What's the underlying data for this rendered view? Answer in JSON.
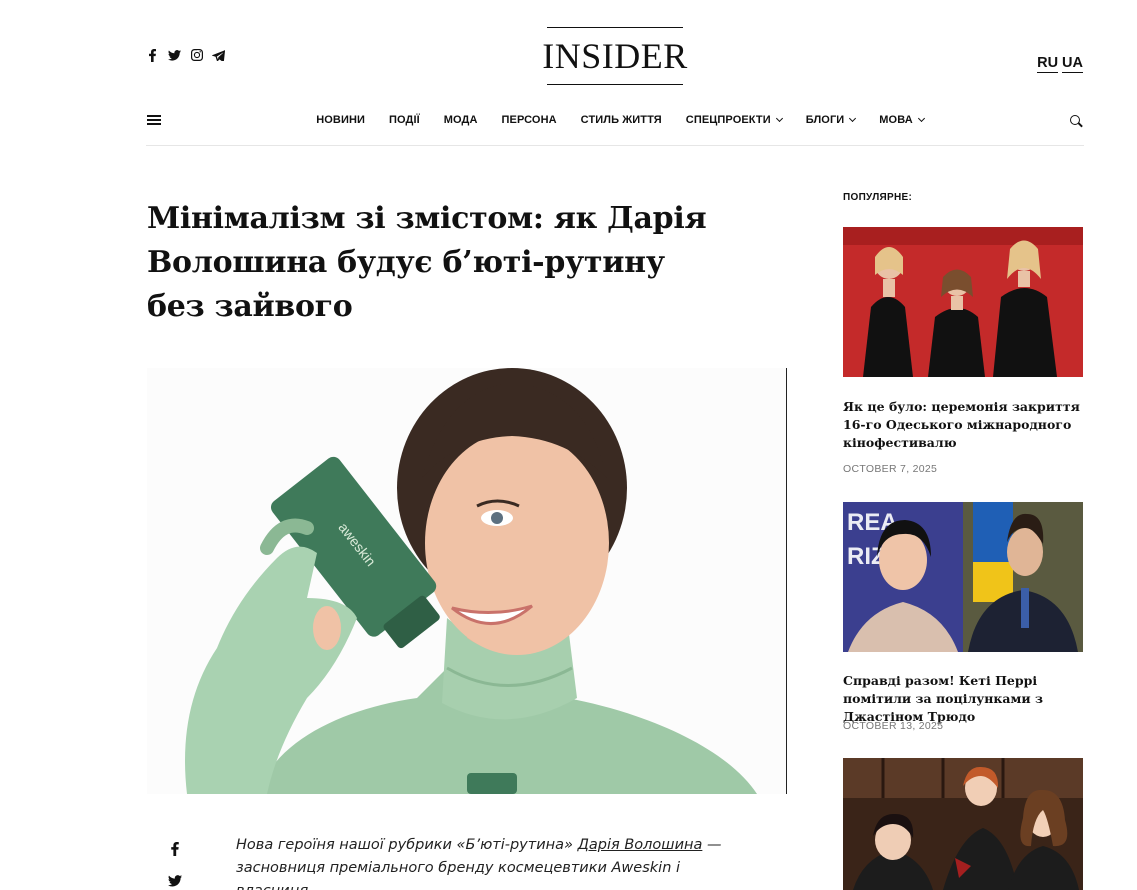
{
  "header": {
    "logo": "INSIDER",
    "social_icons": [
      "facebook-icon",
      "twitter-icon",
      "instagram-icon",
      "telegram-icon"
    ],
    "languages": [
      "RU",
      "UA"
    ]
  },
  "nav": {
    "items": [
      {
        "label": "НОВИНИ",
        "dropdown": false
      },
      {
        "label": "ПОДІЇ",
        "dropdown": false
      },
      {
        "label": "МОДА",
        "dropdown": false
      },
      {
        "label": "ПЕРСОНА",
        "dropdown": false
      },
      {
        "label": "СТИЛЬ ЖИТТЯ",
        "dropdown": false
      },
      {
        "label": "СПЕЦПРОЕКТИ",
        "dropdown": true
      },
      {
        "label": "БЛОГИ",
        "dropdown": true
      },
      {
        "label": "МОВА",
        "dropdown": true
      }
    ]
  },
  "article": {
    "title": "Мінімалізм зі змістом: як Дарія Волошина будує б’юті-рутину без зайвого",
    "lead_part1": "Нова героїня нашої рубрики «Б’юті-рутина» ",
    "lead_link": "Дарія Волошина",
    "lead_part2": " — засновниця преміального бренду космецевтики Aweskin і власниця",
    "share_icons": [
      "facebook-icon",
      "twitter-icon"
    ],
    "product_text": "aweskin"
  },
  "sidebar": {
    "heading": "ПОПУЛЯРНЕ:",
    "posts": [
      {
        "title": "Як це було: церемонія закриття 16-го Одеського міжнародного кінофестивалю",
        "date": "OCTOBER 7, 2025"
      },
      {
        "title": "Справді разом! Кеті Перрі помітили за поцілунками з Джастіном Трюдо",
        "date": "OCTOBER 13, 2025"
      }
    ]
  },
  "colors": {
    "text": "#111111",
    "hero_garment": "#9fc9a7",
    "product_tube": "#3f7a5a",
    "red_carpet": "#c42a2a"
  }
}
